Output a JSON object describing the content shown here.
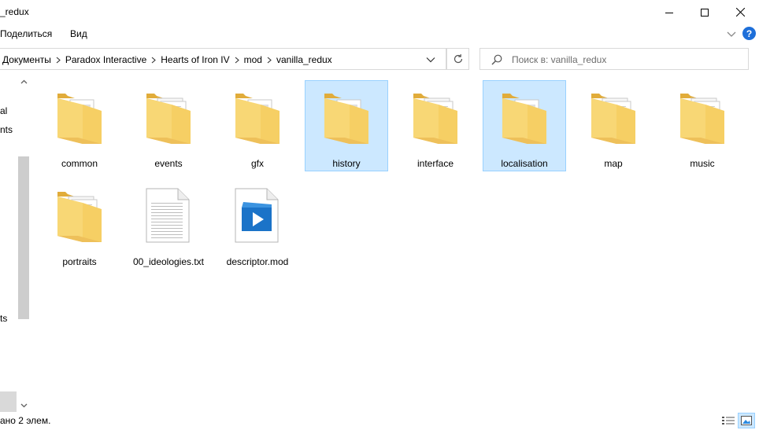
{
  "window": {
    "title": "_redux"
  },
  "ribbon": {
    "tab_share": "Поделиться",
    "tab_view": "Вид",
    "help_label": "?"
  },
  "address": {
    "crumbs": [
      "Документы",
      "Paradox Interactive",
      "Hearts of Iron IV",
      "mod",
      "vanilla_redux"
    ]
  },
  "search": {
    "placeholder": "Поиск в: vanilla_redux"
  },
  "navpane": {
    "items": [
      "al",
      "nts",
      "ts"
    ]
  },
  "files": [
    {
      "name": "common",
      "type": "folder-docs",
      "selected": false
    },
    {
      "name": "events",
      "type": "folder-pages",
      "selected": false
    },
    {
      "name": "gfx",
      "type": "folder-docs",
      "selected": false
    },
    {
      "name": "history",
      "type": "folder-docs",
      "selected": true
    },
    {
      "name": "interface",
      "type": "folder-pages",
      "selected": false
    },
    {
      "name": "localisation",
      "type": "folder-docs",
      "selected": true
    },
    {
      "name": "map",
      "type": "folder-pages",
      "selected": false
    },
    {
      "name": "music",
      "type": "folder-media",
      "selected": false
    },
    {
      "name": "portraits",
      "type": "folder-pages",
      "selected": false
    },
    {
      "name": "00_ideologies.txt",
      "type": "text-file",
      "selected": false
    },
    {
      "name": "descriptor.mod",
      "type": "video-file",
      "selected": false
    }
  ],
  "status": {
    "text": "ано 2 элем."
  },
  "colors": {
    "selection_bg": "#cce8ff",
    "selection_border": "#99d1ff",
    "folder": "#f8d775"
  }
}
